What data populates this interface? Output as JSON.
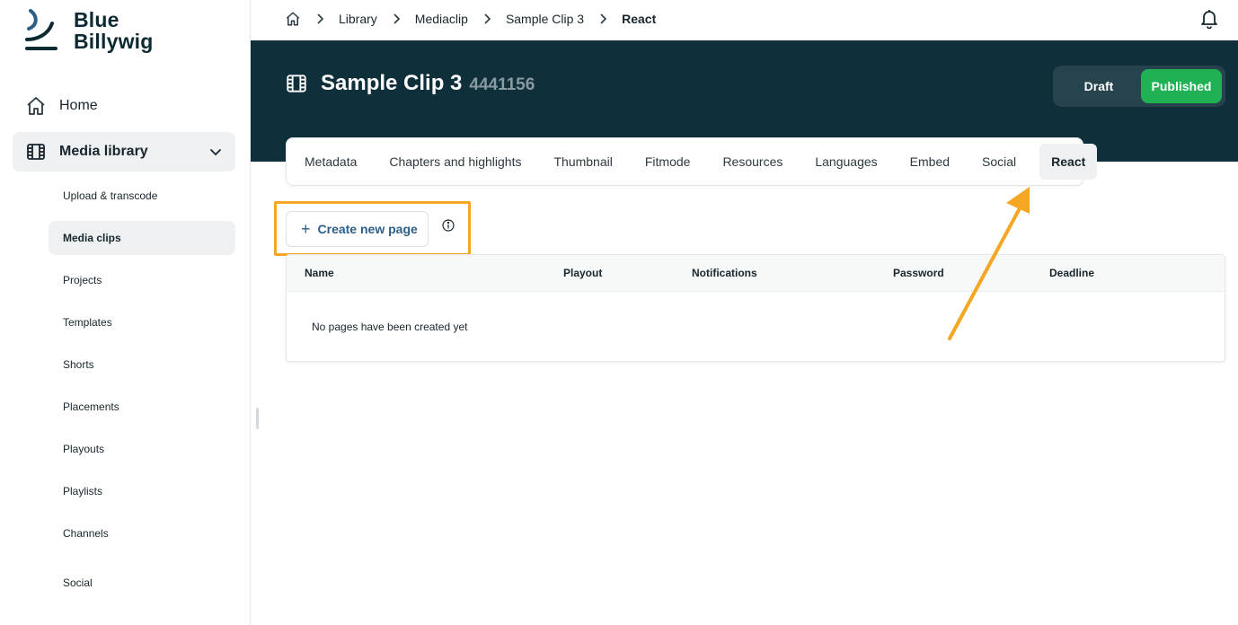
{
  "brand": {
    "line1": "Blue",
    "line2": "Billywig"
  },
  "sidebar": {
    "home_label": "Home",
    "media_label": "Media library",
    "items": [
      {
        "label": "Upload & transcode"
      },
      {
        "label": "Media clips",
        "active": true
      },
      {
        "label": "Projects"
      },
      {
        "label": "Templates"
      },
      {
        "label": "Shorts"
      },
      {
        "label": "Placements"
      },
      {
        "label": "Playouts"
      },
      {
        "label": "Playlists"
      },
      {
        "label": "Channels"
      },
      {
        "label": "Social"
      }
    ]
  },
  "breadcrumb": [
    "Library",
    "Mediaclip",
    "Sample Clip 3",
    "React"
  ],
  "clip": {
    "title": "Sample Clip 3",
    "id": "4441156"
  },
  "status": {
    "draft": "Draft",
    "published": "Published",
    "selected": "Published",
    "published_color": "#1fb154"
  },
  "tabs": [
    "Metadata",
    "Chapters and highlights",
    "Thumbnail",
    "Fitmode",
    "Resources",
    "Languages",
    "Embed",
    "Social",
    "React"
  ],
  "active_tab": "React",
  "actions": {
    "create_label": "Create new page"
  },
  "table": {
    "columns": [
      "Name",
      "Playout",
      "Notifications",
      "Password",
      "Deadline"
    ],
    "empty_text": "No pages have been created yet"
  },
  "colors": {
    "header_bg": "#0f2f3b",
    "annotation": "#f5a623",
    "link": "#2b5f8a"
  }
}
